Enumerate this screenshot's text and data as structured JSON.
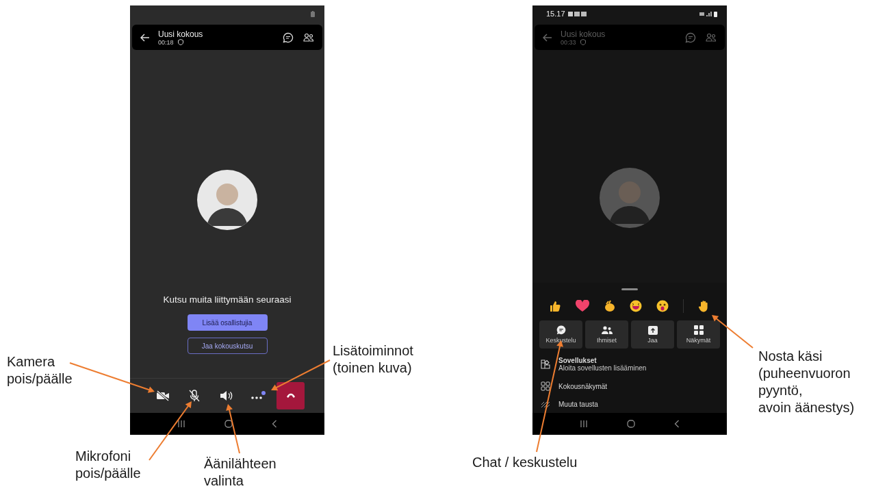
{
  "left_screen": {
    "title": "Uusi kokous",
    "elapsed": "00:18",
    "invite_text": "Kutsu muita liittymään seuraasi",
    "buttons": [
      {
        "label": "Lisää osallistujia",
        "kind": "primary"
      },
      {
        "label": "Jaa kokouskutsu",
        "kind": "outline"
      }
    ],
    "controls": [
      {
        "kind": "camera",
        "off": true
      },
      {
        "kind": "microphone",
        "off": true
      },
      {
        "kind": "speaker",
        "off": false
      },
      {
        "kind": "more",
        "badge": true
      },
      {
        "kind": "hang-up"
      }
    ]
  },
  "right_screen": {
    "status_time": "15.17",
    "title": "Uusi kokous",
    "elapsed": "00:33",
    "reactions": [
      {
        "kind": "thumbs-up"
      },
      {
        "kind": "heart"
      },
      {
        "kind": "clap"
      },
      {
        "kind": "laugh"
      },
      {
        "kind": "surprised"
      },
      {
        "kind": "raise-hand"
      }
    ],
    "tiles": [
      {
        "label": "Keskustelu",
        "kind": "chat"
      },
      {
        "label": "Ihmiset",
        "kind": "people"
      },
      {
        "label": "Jaa",
        "kind": "share"
      },
      {
        "label": "Näkymät",
        "kind": "views"
      }
    ],
    "menu": [
      {
        "title": "Sovellukset",
        "subtitle": "Aloita sovellusten lisääminen",
        "kind": "apps"
      },
      {
        "title": "Kokousnäkymät",
        "kind": "layout"
      },
      {
        "title": "Muuta tausta",
        "kind": "background"
      }
    ]
  },
  "annotations": [
    {
      "text": "Kamera\npois/päälle"
    },
    {
      "text": "Lisätoiminnot\n(toinen kuva)"
    },
    {
      "text": "Mikrofoni\npois/päälle"
    },
    {
      "text": "Äänilähteen\nvalinta"
    },
    {
      "text": "Chat / keskustelu"
    },
    {
      "text": "Nosta käsi\n(puheenvuoron\npyyntö,\navoin äänestys)"
    }
  ]
}
